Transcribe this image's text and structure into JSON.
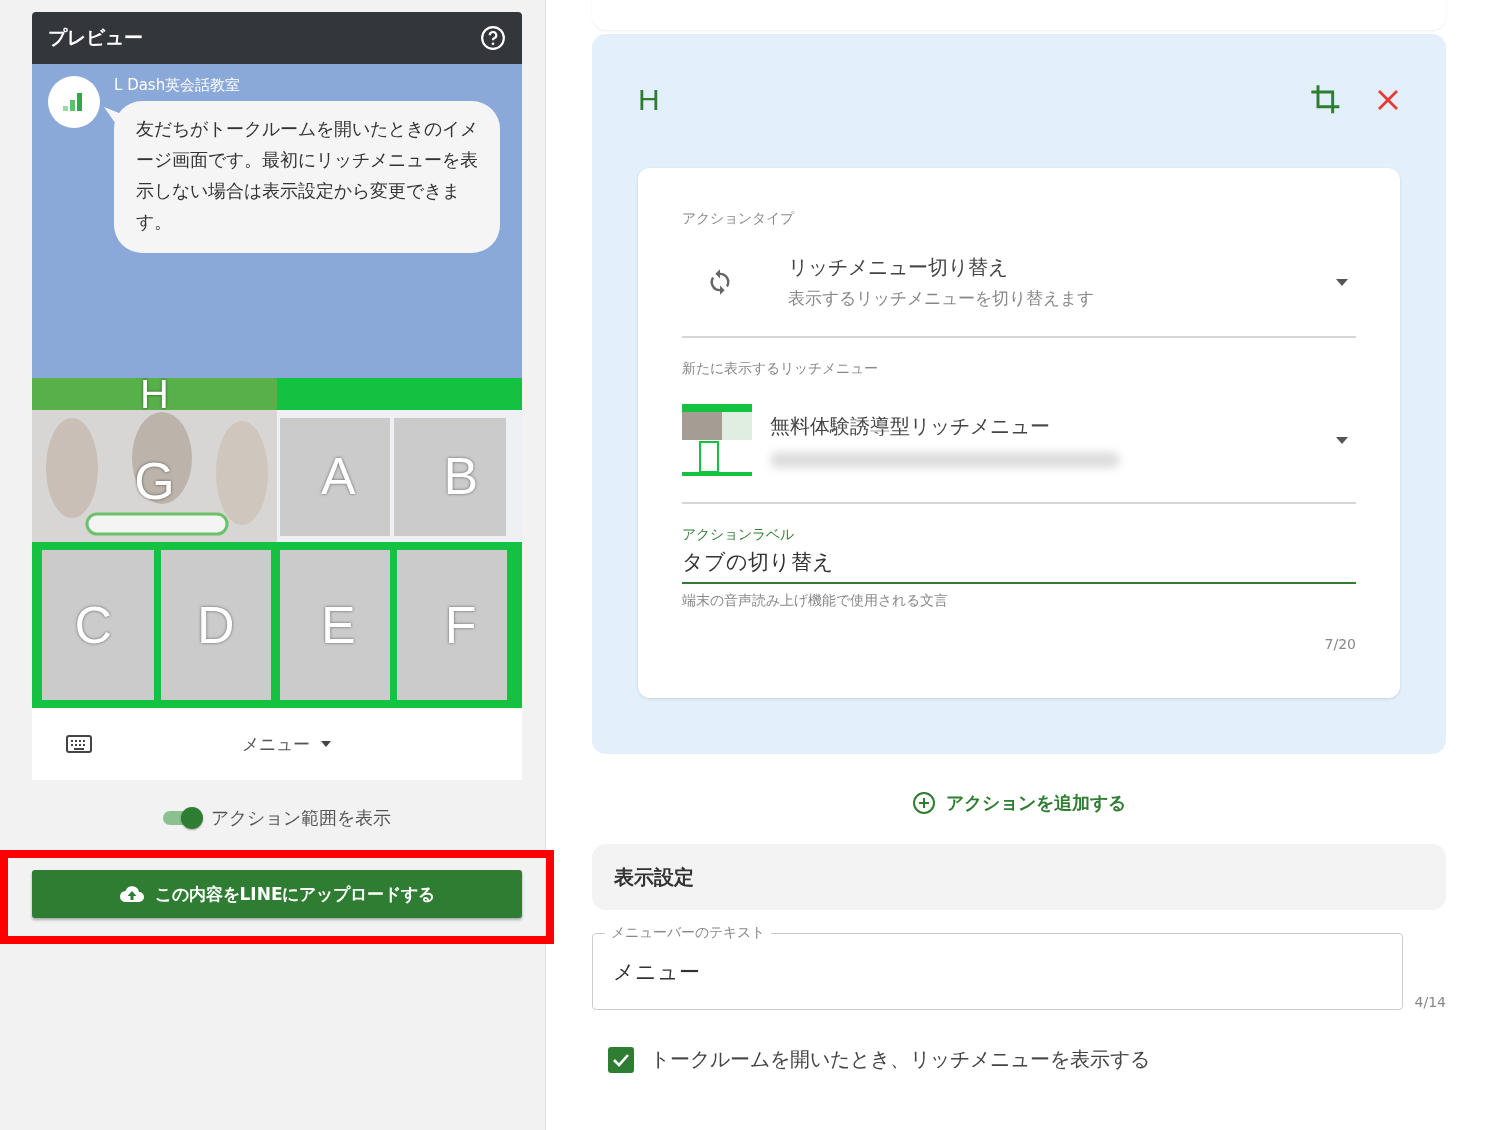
{
  "preview": {
    "title": "プレビュー",
    "account_name": "L Dash英会話教室",
    "message": "友だちがトークルームを開いたときのイメージ画面です。最初にリッチメニューを表示しない場合は表示設定から変更できます。",
    "action_areas": [
      {
        "label": "H",
        "kind": "tab"
      },
      {
        "label": "G",
        "kind": "hero"
      },
      {
        "label": "A",
        "kind": "tile"
      },
      {
        "label": "B",
        "kind": "tile"
      },
      {
        "label": "C",
        "kind": "tile"
      },
      {
        "label": "D",
        "kind": "tile"
      },
      {
        "label": "E",
        "kind": "tile"
      },
      {
        "label": "F",
        "kind": "tile"
      }
    ],
    "menu_bar": {
      "label": "メニュー"
    },
    "toggle": {
      "label": "アクション範囲を表示",
      "on": true
    },
    "upload_button": {
      "label": "この内容をLINEにアップロードする",
      "highlighted": true
    }
  },
  "editor": {
    "action": {
      "label": "H"
    },
    "action_type": {
      "label": "アクションタイプ",
      "title": "リッチメニュー切り替え",
      "description": "表示するリッチメニューを切り替えます"
    },
    "new_menu": {
      "label": "新たに表示するリッチメニュー",
      "title": "無料体験誘導型リッチメニュー"
    },
    "action_label": {
      "label": "アクションラベル",
      "value": "タブの切り替え",
      "helper": "端末の音声読み上げ機能で使用される文言",
      "counter": "7/20"
    },
    "add_action": "アクションを追加する",
    "display_settings": {
      "heading": "表示設定",
      "menu_bar_text": {
        "label": "メニューバーのテキスト",
        "value": "メニュー",
        "counter": "4/14"
      },
      "show_on_open": {
        "label": "トークルームを開いたとき、リッチメニューを表示する",
        "checked": true
      }
    }
  }
}
